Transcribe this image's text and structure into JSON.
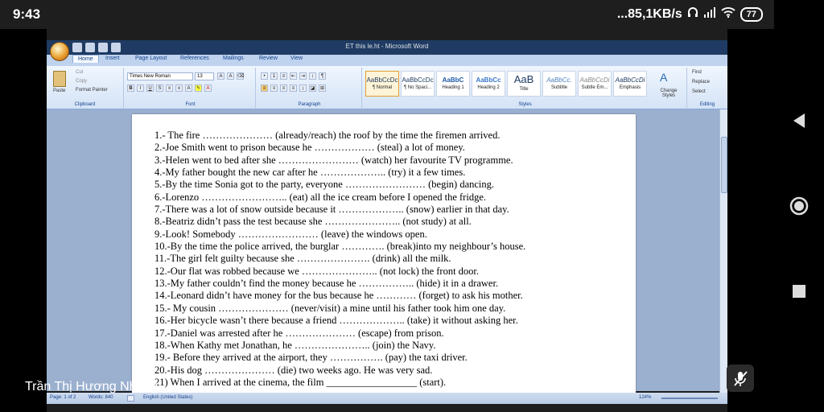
{
  "statusbar": {
    "time": "9:43",
    "network": "...85,1KB/s",
    "battery": "77"
  },
  "window": {
    "title": "ET this le.ht - Microsoft Word"
  },
  "tabs": [
    "Home",
    "Insert",
    "Page Layout",
    "References",
    "Mailings",
    "Review",
    "View"
  ],
  "clipboard": {
    "paste": "Paste",
    "cut": "Cut",
    "copy": "Copy",
    "format_painter": "Format Painter",
    "label": "Clipboard"
  },
  "font": {
    "name": "Times New Roman",
    "size": "13",
    "label": "Font"
  },
  "paragraph": {
    "label": "Paragraph"
  },
  "styles": {
    "label": "Styles",
    "items": [
      {
        "sample": "AaBbCcDc",
        "name": "¶ Normal"
      },
      {
        "sample": "AaBbCcDc",
        "name": "¶ No Spaci..."
      },
      {
        "sample": "AaBbC",
        "name": "Heading 1"
      },
      {
        "sample": "AaBbCc",
        "name": "Heading 2"
      },
      {
        "sample": "AaB",
        "name": "Title"
      },
      {
        "sample": "AaBbCc.",
        "name": "Subtitle"
      },
      {
        "sample": "AaBbCcDi",
        "name": "Subtle Em..."
      },
      {
        "sample": "AaBbCcDi",
        "name": "Emphasis"
      }
    ],
    "change_styles": "Change Styles"
  },
  "editing": {
    "label": "Editing",
    "find": "Find",
    "replace": "Replace",
    "select": "Select"
  },
  "document": {
    "lines": [
      "1.- The fire ………………… (already/reach) the roof by the time the firemen arrived.",
      "2.-Joe Smith went to prison because he ……………… (steal) a lot of money.",
      "3.-Helen went to bed after she …………………… (watch) her favourite TV programme.",
      "4.-My father bought the new car after he ……………….. (try) it a few times.",
      "5.-By the time Sonia got to the party, everyone …………………… (begin) dancing.",
      "6.-Lorenzo …………………….. (eat) all the ice cream before I opened the fridge.",
      "7.-There was a lot of snow outside because it ……………….. (snow) earlier in that day.",
      "8.-Beatriz didn’t pass the test because she ………………….. (not study) at all.",
      "9.-Look! Somebody …………………… (leave) the windows open.",
      "10.-By the time the police arrived, the burglar …………. (break)into my neighbour’s house.",
      "11.-The girl felt guilty because she …………………. (drink) all the milk.",
      "12.-Our flat was robbed because we ………………….. (not lock) the front door.",
      "13.-My father couldn’t find the money because he …………….. (hide) it in a drawer.",
      "14.-Leonard didn’t have money for the bus because he ………… (forget) to ask his mother.",
      "15.- My cousin ………………… (never/visit) a mine until his father took him one day.",
      "16.-Her bicycle wasn’t there because a friend ……………….. (take) it without asking her.",
      "17.-Daniel was arrested after he ………………… (escape) from prison.",
      "18.-When Kathy met Jonathan, he ………………….. (join) the Navy.",
      "19.- Before they arrived at the airport, they ……………. (pay) the taxi driver.",
      "20.-His dog ………………… (die) two weeks ago. He was very sad.",
      "21) When I arrived at the cinema, the film __________________ (start)."
    ]
  },
  "word_status": {
    "page": "Page: 1 of 2",
    "words": "Words: 840",
    "language": "English (United States)",
    "zoom": "124%"
  },
  "caption": "Trần Thị Hương Nhung"
}
